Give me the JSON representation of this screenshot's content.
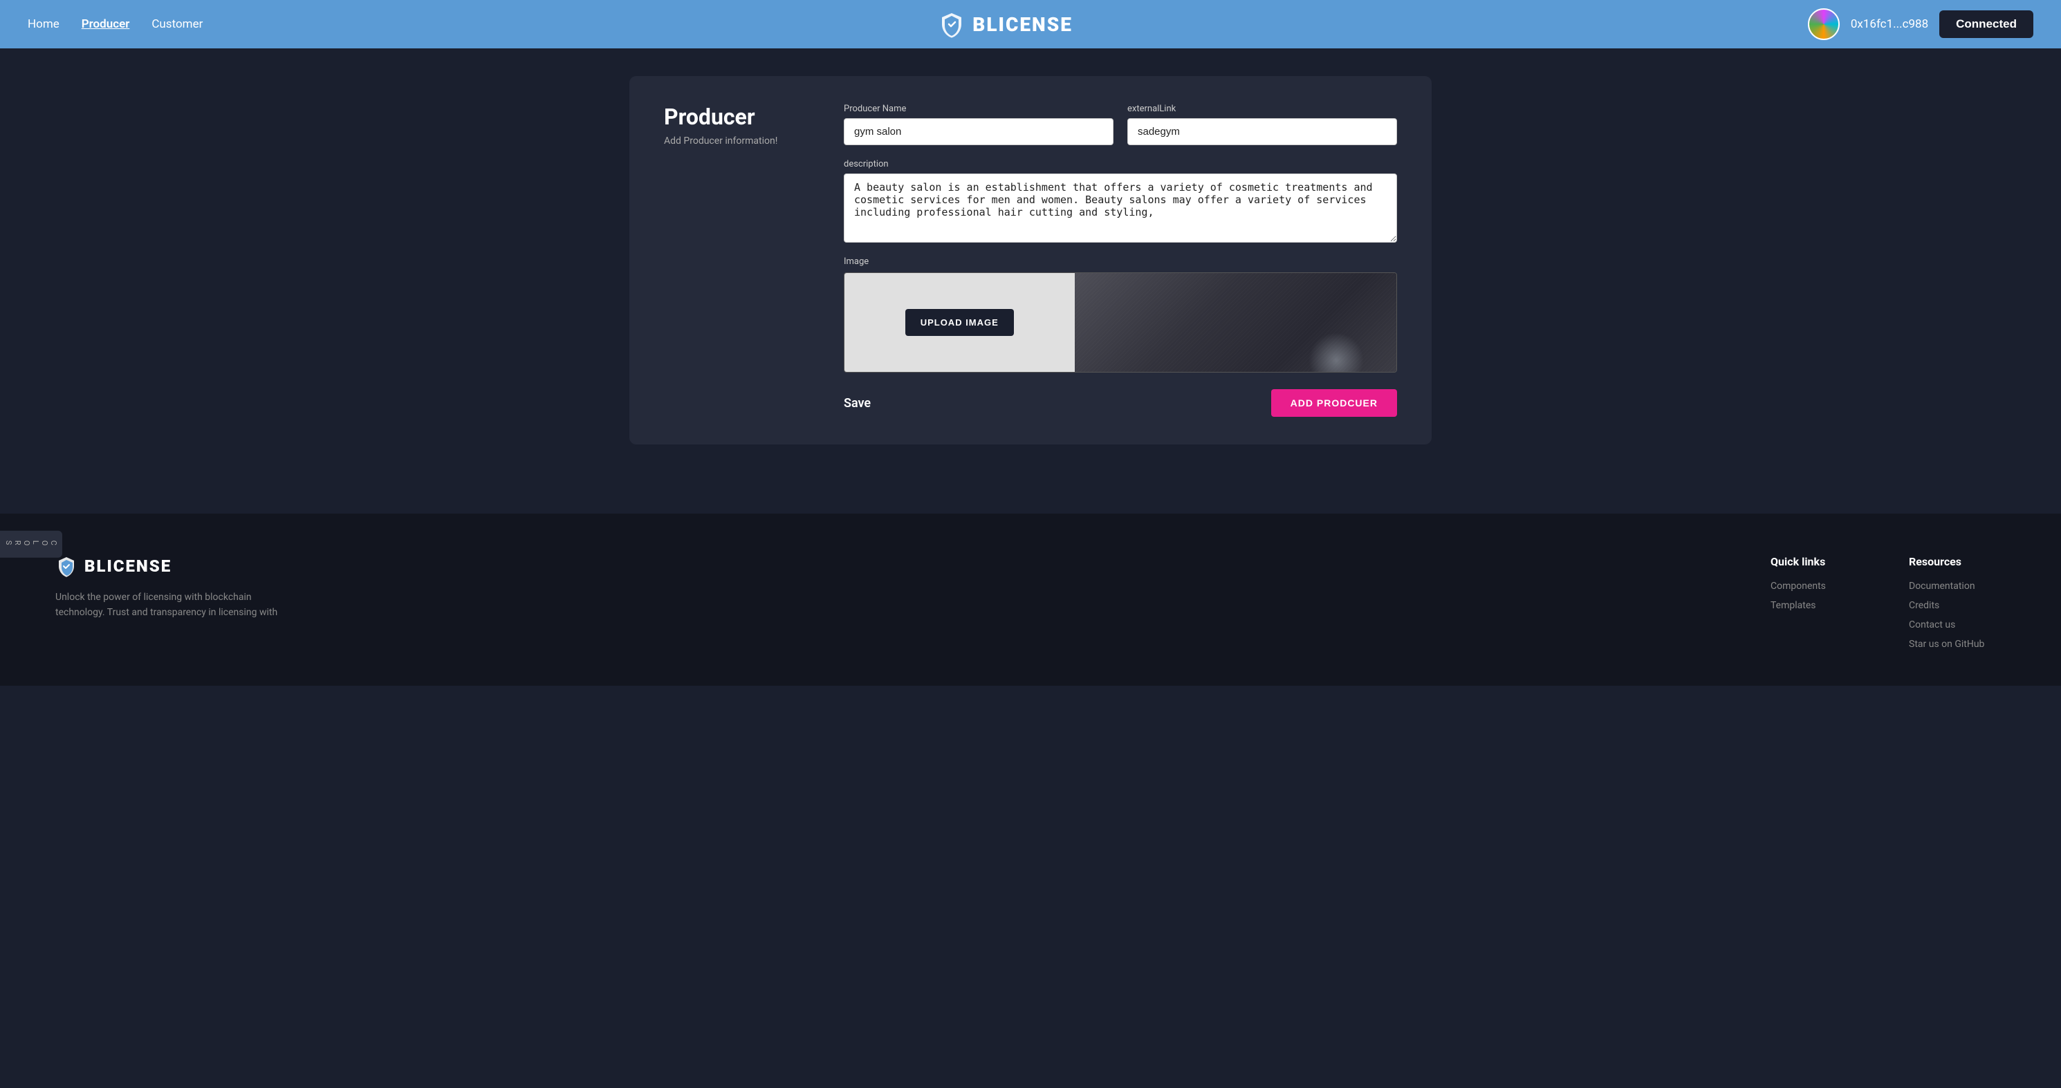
{
  "nav": {
    "home_label": "Home",
    "producer_label": "Producer",
    "customer_label": "Customer",
    "logo_text": "BLICENSE",
    "wallet_address": "0x16fc1...c988",
    "connected_label": "Connected"
  },
  "colors_panel": {
    "label": "COLORS"
  },
  "producer_card": {
    "title": "Producer",
    "subtitle": "Add Producer information!",
    "producer_name_label": "Producer Name",
    "producer_name_value": "gym salon",
    "external_link_label": "externalLink",
    "external_link_value": "sadegym",
    "description_label": "description",
    "description_value": "A beauty salon is an establishment that offers a variety of cosmetic treatments and cosmetic services for men and women. Beauty salons may offer a variety of services including professional hair cutting and styling,",
    "image_label": "Image",
    "upload_btn_label": "UPLOAD IMAGE",
    "save_label": "Save",
    "add_producer_btn_label": "ADD PRODCUER"
  },
  "footer": {
    "logo_text": "BLICENSE",
    "description": "Unlock the power of licensing with blockchain technology. Trust and transparency in licensing with",
    "quick_links": {
      "title": "Quick links",
      "items": [
        {
          "label": "Components",
          "href": "#"
        },
        {
          "label": "Templates",
          "href": "#"
        }
      ]
    },
    "resources": {
      "title": "Resources",
      "items": [
        {
          "label": "Documentation",
          "href": "#"
        },
        {
          "label": "Credits",
          "href": "#"
        },
        {
          "label": "Contact us",
          "href": "#"
        },
        {
          "label": "Star us on GitHub",
          "href": "#"
        }
      ]
    }
  }
}
